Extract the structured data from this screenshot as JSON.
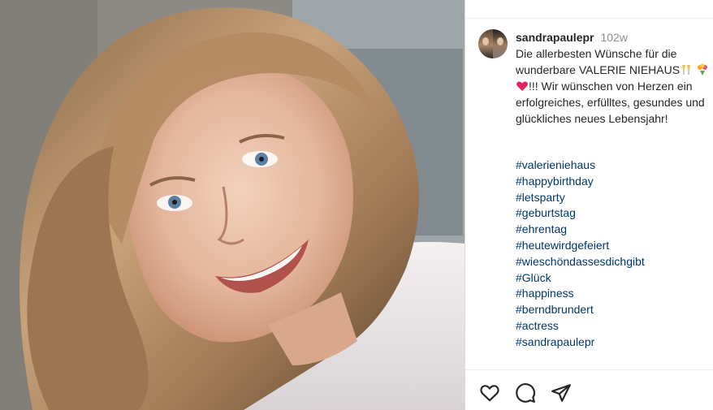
{
  "post": {
    "username": "sandrapaulepr",
    "time_ago": "102w",
    "caption_line1": "Die allerbesten Wünsche für die",
    "caption_line2": "wunderbare VALERIE NIEHAUS",
    "caption_line3": "!!! Wir wünschen von Herzen ein",
    "caption_line4": "erfolgreiches, erfülltes, gesundes und",
    "caption_line5": "glückliches neues Lebensjahr!",
    "hashtags": [
      "#valerieniehaus",
      "#happybirthday",
      "#letsparty",
      "#geburtstag",
      "#ehrentag",
      "#heutewirdgefeiert",
      "#wieschöndassesdichgibt",
      "#Glück",
      "#happiness",
      "#berndbrundert",
      "#actress",
      "#sandrapaulepr"
    ]
  },
  "actions": {
    "like_icon": "heart-outline-icon",
    "comment_icon": "comment-bubble-icon",
    "share_icon": "paper-plane-icon"
  },
  "colors": {
    "hashtag": "#00376b",
    "text": "#262626",
    "muted": "#8e8e8e",
    "heart_emoji": "#e0245e"
  }
}
